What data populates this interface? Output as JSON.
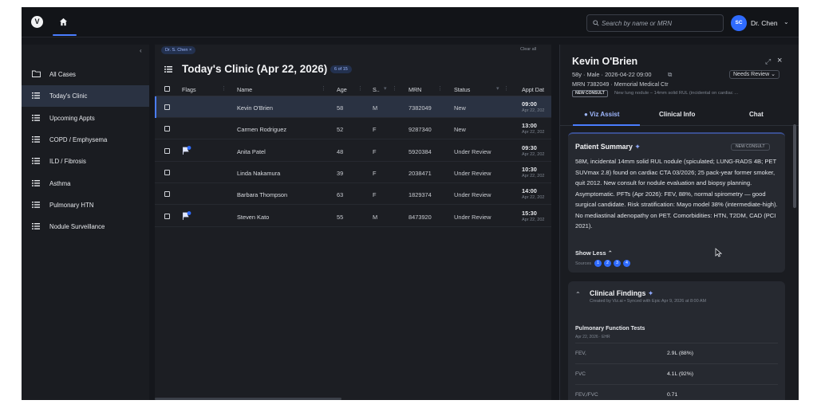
{
  "topbar": {
    "logo": "V",
    "search_placeholder": "Search by name or MRN",
    "user_initials": "SC",
    "user_name": "Dr. Chen"
  },
  "sidebar": {
    "items": [
      {
        "label": "All Cases",
        "icon": "folder-icon",
        "active": false
      },
      {
        "label": "Today's Clinic",
        "icon": "list-icon",
        "active": true
      },
      {
        "label": "Upcoming Appts",
        "icon": "list-icon",
        "active": false
      },
      {
        "label": "COPD / Emphysema",
        "icon": "list-icon",
        "active": false
      },
      {
        "label": "ILD / Fibrosis",
        "icon": "list-icon",
        "active": false
      },
      {
        "label": "Asthma",
        "icon": "list-icon",
        "active": false
      },
      {
        "label": "Pulmonary HTN",
        "icon": "list-icon",
        "active": false
      },
      {
        "label": "Nodule Surveillance",
        "icon": "list-icon",
        "active": false
      }
    ]
  },
  "main": {
    "filter_chip": "Dr. S. Chen ×",
    "clear_all": "Clear all",
    "title": "Today's Clinic (Apr 22, 2026)",
    "count": "6 of 15",
    "columns": [
      "Flags",
      "Name",
      "Age",
      "S..",
      "MRN",
      "Status",
      "Appt Dat"
    ],
    "rows": [
      {
        "flag": false,
        "name": "Kevin O'Brien",
        "age": "58",
        "sex": "M",
        "mrn": "7382049",
        "status": "New",
        "time": "09:00",
        "date": "Apr 22, 202",
        "selected": true
      },
      {
        "flag": false,
        "name": "Carmen Rodriguez",
        "age": "52",
        "sex": "F",
        "mrn": "9287340",
        "status": "New",
        "time": "13:00",
        "date": "Apr 22, 202",
        "selected": false
      },
      {
        "flag": true,
        "name": "Anita Patel",
        "age": "48",
        "sex": "F",
        "mrn": "5920384",
        "status": "Under Review",
        "time": "09:30",
        "date": "Apr 22, 202",
        "selected": false
      },
      {
        "flag": false,
        "name": "Linda Nakamura",
        "age": "39",
        "sex": "F",
        "mrn": "2038471",
        "status": "Under Review",
        "time": "10:30",
        "date": "Apr 22, 202",
        "selected": false
      },
      {
        "flag": false,
        "name": "Barbara Thompson",
        "age": "63",
        "sex": "F",
        "mrn": "1829374",
        "status": "Under Review",
        "time": "14:00",
        "date": "Apr 22, 202",
        "selected": false
      },
      {
        "flag": true,
        "name": "Steven Kato",
        "age": "55",
        "sex": "M",
        "mrn": "8473920",
        "status": "Under Review",
        "time": "15:30",
        "date": "Apr 22, 202",
        "selected": false
      }
    ]
  },
  "panel": {
    "name": "Kevin O'Brien",
    "meta": "58y · Male · 2026-04-22 09:00",
    "review_status": "Needs Review ⌄",
    "mrn_line": "MRN 7382049 · Memorial Medical Ctr",
    "consult_badge": "NEW CONSULT",
    "consult_text": "New lung nodule – 14mm solid RUL (incidental on cardiac ...",
    "tabs": [
      "● Viz Assist",
      "Clinical Info",
      "Chat"
    ],
    "summary": {
      "title": "Patient Summary",
      "badge": "NEW CONSULT",
      "text": "58M, incidental 14mm solid RUL nodule (spiculated; LUNG-RADS 4B; PET SUVmax 2.8) found on cardiac CTA 03/2026; 25 pack-year former smoker, quit 2012. New consult for nodule evaluation and biopsy planning. Asymptomatic. PFTs (Apr 2026): FEV, 88%, normal spirometry — good surgical candidate. Risk stratification: Mayo model 38% (intermediate-high). No mediastinal adenopathy on PET. Comorbidities: HTN, T2DM, CAD (PCI 2021).",
      "show_less": "Show Less ⌃",
      "sources_label": "Sources",
      "sources": [
        "1",
        "2",
        "3",
        "4"
      ]
    },
    "findings": {
      "title": "Clinical Findings",
      "subtitle": "Created by Viz.ai • Synced with Epic Apr 9, 2026 at 8:00 AM",
      "pft_title": "Pulmonary Function Tests",
      "pft_date": "Apr 22, 2026 · EHR",
      "rows": [
        {
          "label": "FEV,",
          "value": "2.9L (88%)"
        },
        {
          "label": "FVC",
          "value": "4.1L (92%)"
        },
        {
          "label": "FEV,/FVC",
          "value": "0.71"
        }
      ]
    }
  },
  "colors": {
    "accent": "#4a7dff",
    "background": "#15171c",
    "selected_row": "#2a3242"
  }
}
